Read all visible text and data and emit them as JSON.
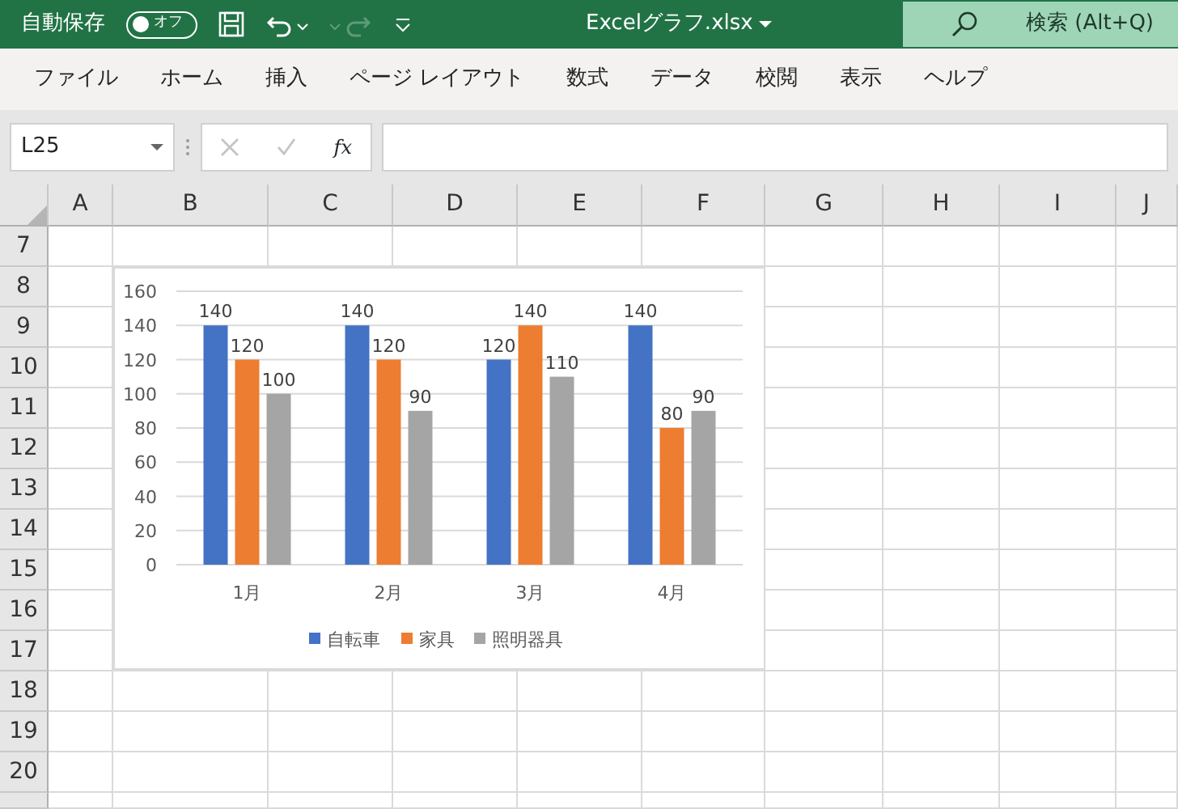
{
  "title_bar": {
    "autosave_label": "自動保存",
    "autosave": {
      "on": false,
      "label": "オフ"
    },
    "undo": {
      "disabled": false
    },
    "redo": {
      "disabled": true
    },
    "title": "Excelグラフ.xlsx",
    "search_placeholder": "検索 (Alt+Q)"
  },
  "ribbon_tabs": [
    "ファイル",
    "ホーム",
    "挿入",
    "ページ レイアウト",
    "数式",
    "データ",
    "校閲",
    "表示",
    "ヘルプ"
  ],
  "formula_bar": {
    "name_box": "L25",
    "cancel": {
      "disabled": true
    },
    "enter": {
      "disabled": true
    },
    "function_label": "fx"
  },
  "columns": [
    "A",
    "B",
    "C",
    "D",
    "E",
    "F",
    "G",
    "H",
    "I",
    "J"
  ],
  "rows": [
    "7",
    "8",
    "9",
    "10",
    "11",
    "12",
    "13",
    "14",
    "15",
    "16",
    "17",
    "18",
    "19",
    "20"
  ],
  "chart": {
    "chart_data": {
      "type": "bar",
      "categories": [
        "1月",
        "2月",
        "3月",
        "4月"
      ],
      "series": [
        {
          "name": "自転車",
          "color": "#4472c4",
          "values": [
            140,
            140,
            120,
            140
          ]
        },
        {
          "name": "家具",
          "color": "#ed7d31",
          "values": [
            120,
            120,
            140,
            80
          ]
        },
        {
          "name": "照明器具",
          "color": "#a5a5a5",
          "values": [
            100,
            90,
            110,
            90
          ]
        }
      ],
      "ylim": [
        0,
        160
      ],
      "yticks": [
        0,
        20,
        40,
        60,
        80,
        100,
        120,
        140,
        160
      ],
      "data_labels": true,
      "grid": true,
      "legend": "bottom"
    }
  }
}
